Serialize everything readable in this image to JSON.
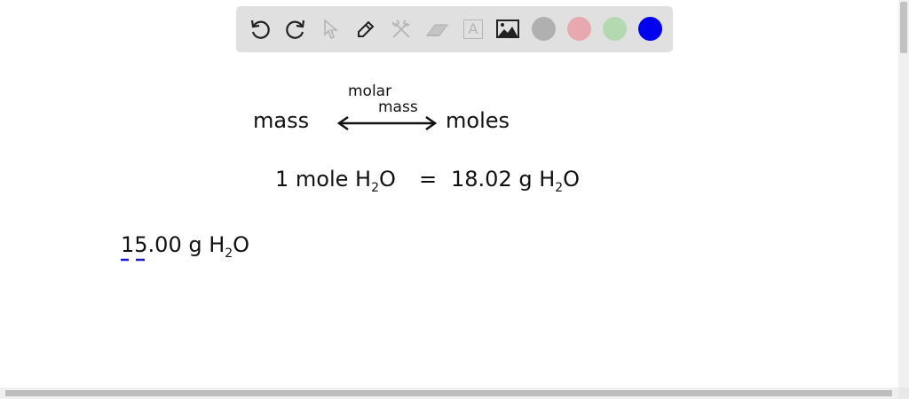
{
  "toolbar": {
    "tools": [
      "undo-icon",
      "redo-icon",
      "select-icon",
      "pen-icon",
      "tools-icon",
      "eraser-icon",
      "text-icon",
      "image-icon"
    ],
    "colors": [
      "#b0b0b0",
      "#e8a8b0",
      "#b4d8b0",
      "#0000ee"
    ],
    "text_tool_label": "A"
  },
  "board": {
    "molar_label": "molar",
    "mass_label_small": "mass",
    "left_term": "mass",
    "right_term": "moles",
    "eq_left": "1 mole H",
    "eq_sub1": "2",
    "eq_o1": "O",
    "eq_equals": "=",
    "eq_right": "18.02 g H",
    "eq_sub2": "2",
    "eq_o2": "O",
    "given": "15.00 g H",
    "given_sub": "2",
    "given_o": "O",
    "ink_color": "#111111",
    "highlight_color": "#1a1acc"
  }
}
